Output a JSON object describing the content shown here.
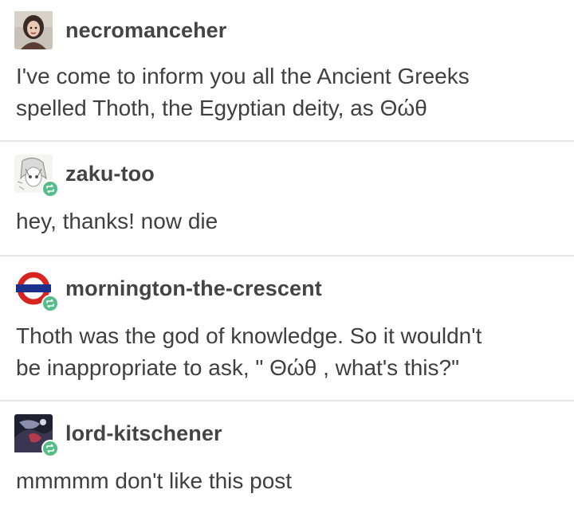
{
  "posts": [
    {
      "username": "necromanceher",
      "text": "I've come to inform you all the Ancient Greeks\nspelled Thoth, the Egyptian deity, as Θώθ",
      "avatar_icon": "user-avatar-photo",
      "reblogged": false
    },
    {
      "username": "zaku-too",
      "text": "hey, thanks! now die",
      "avatar_icon": "anime-avatar",
      "reblogged": true
    },
    {
      "username": "mornington-the-crescent",
      "text": "Thoth was the god of knowledge. So it wouldn't\nbe inappropriate to ask, \" Θώθ , what's this?\"",
      "avatar_icon": "underground-roundel-avatar",
      "reblogged": true
    },
    {
      "username": "lord-kitschener",
      "text": "mmmmm don't like this post",
      "avatar_icon": "dark-art-avatar",
      "reblogged": true
    }
  ],
  "colors": {
    "reblog_badge": "#56bc8a",
    "divider": "#e6e6e6",
    "username": "#444444",
    "text": "#3f3f3f"
  }
}
